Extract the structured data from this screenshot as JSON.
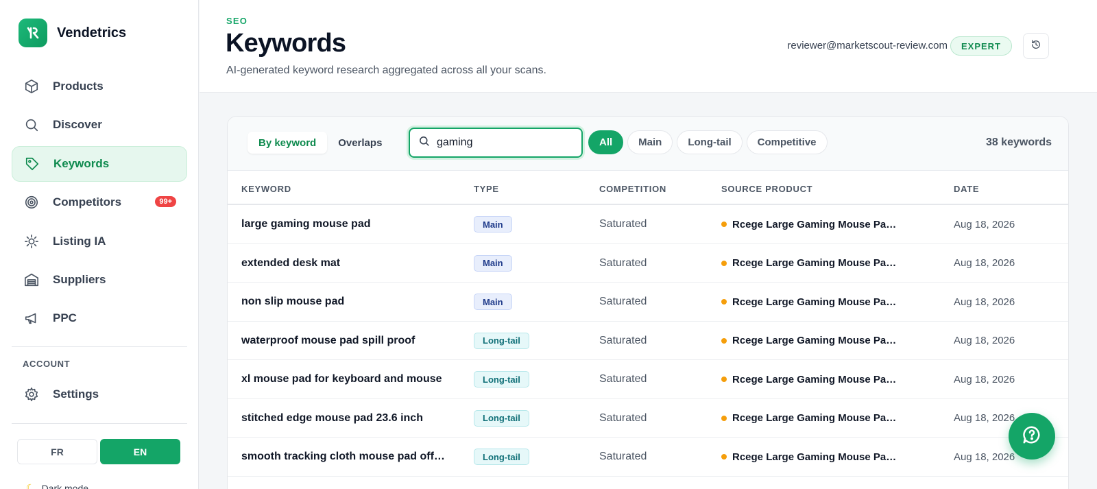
{
  "brand": {
    "name": "Vendetrics"
  },
  "sidebar": {
    "items": [
      {
        "label": "Products",
        "icon": "cube-icon"
      },
      {
        "label": "Discover",
        "icon": "search-icon"
      },
      {
        "label": "Keywords",
        "icon": "tag-icon",
        "active": true
      },
      {
        "label": "Competitors",
        "icon": "target-icon",
        "badge": "99+"
      },
      {
        "label": "Listing IA",
        "icon": "sparkle-icon"
      },
      {
        "label": "Suppliers",
        "icon": "warehouse-icon"
      },
      {
        "label": "PPC",
        "icon": "megaphone-icon"
      }
    ],
    "account_label": "ACCOUNT",
    "settings_label": "Settings",
    "lang_fr": "FR",
    "lang_en": "EN",
    "dark_mode_label": "Dark mode"
  },
  "header": {
    "eyebrow": "SEO",
    "title": "Keywords",
    "subtitle": "AI-generated keyword research aggregated across all your scans.",
    "email": "reviewer@marketscout-review.com",
    "plan_badge": "EXPERT"
  },
  "toolbar": {
    "tab_by_keyword": "By keyword",
    "tab_overlaps": "Overlaps",
    "search_value": "gaming",
    "filters": [
      "All",
      "Main",
      "Long-tail",
      "Competitive"
    ],
    "count": "38 keywords"
  },
  "table": {
    "headers": [
      "KEYWORD",
      "TYPE",
      "COMPETITION",
      "SOURCE PRODUCT",
      "DATE"
    ],
    "rows": [
      {
        "keyword": "large gaming mouse pad",
        "type": "Main",
        "competition": "Saturated",
        "source": "Rcege Large Gaming Mouse Pa…",
        "date": "Aug 18, 2026"
      },
      {
        "keyword": "extended desk mat",
        "type": "Main",
        "competition": "Saturated",
        "source": "Rcege Large Gaming Mouse Pa…",
        "date": "Aug 18, 2026"
      },
      {
        "keyword": "non slip mouse pad",
        "type": "Main",
        "competition": "Saturated",
        "source": "Rcege Large Gaming Mouse Pa…",
        "date": "Aug 18, 2026"
      },
      {
        "keyword": "waterproof mouse pad spill proof",
        "type": "Long-tail",
        "competition": "Saturated",
        "source": "Rcege Large Gaming Mouse Pa…",
        "date": "Aug 18, 2026"
      },
      {
        "keyword": "xl mouse pad for keyboard and mouse",
        "type": "Long-tail",
        "competition": "Saturated",
        "source": "Rcege Large Gaming Mouse Pa…",
        "date": "Aug 18, 2026"
      },
      {
        "keyword": "stitched edge mouse pad 23.6 inch",
        "type": "Long-tail",
        "competition": "Saturated",
        "source": "Rcege Large Gaming Mouse Pa…",
        "date": "Aug 18, 2026"
      },
      {
        "keyword": "smooth tracking cloth mouse pad off…",
        "type": "Long-tail",
        "competition": "Saturated",
        "source": "Rcege Large Gaming Mouse Pa…",
        "date": "Aug 18, 2026"
      }
    ]
  },
  "colors": {
    "accent": "#14a567",
    "danger": "#ef4444",
    "dot": "#f59e0b"
  },
  "icons": {
    "help": "chat-help-icon",
    "refresh": "refresh-icon"
  }
}
